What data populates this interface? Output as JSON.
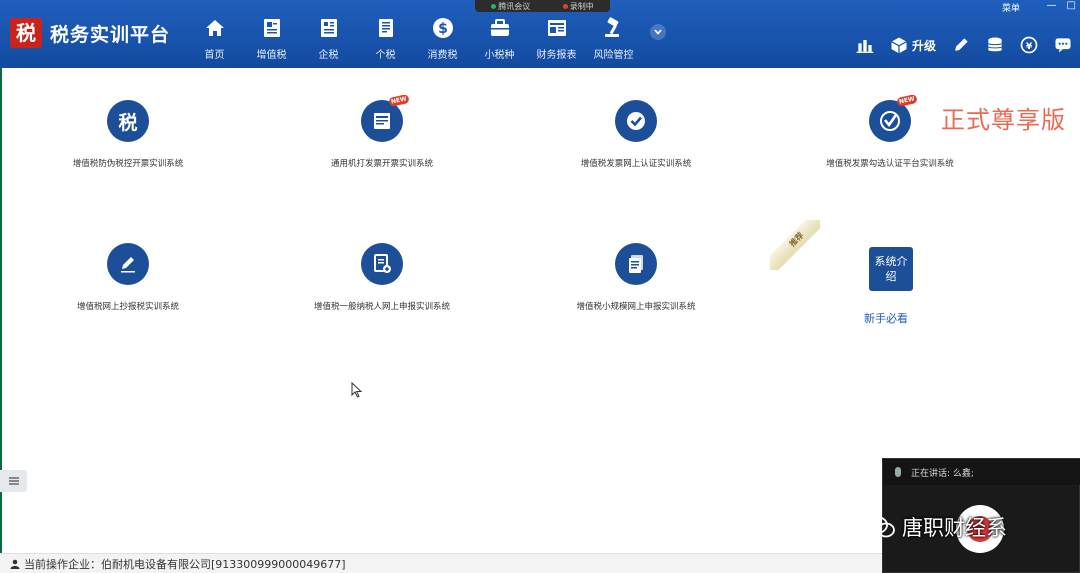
{
  "app": {
    "logo_char": "税",
    "title": "税务实训平台"
  },
  "meeting": {
    "name": "腾讯会议",
    "recording": "录制中"
  },
  "nav": {
    "items": [
      {
        "label": "首页",
        "icon": "home-icon"
      },
      {
        "label": "增值税",
        "icon": "document-icon"
      },
      {
        "label": "企税",
        "icon": "building-icon"
      },
      {
        "label": "个税",
        "icon": "person-doc-icon"
      },
      {
        "label": "消费税",
        "icon": "dollar-icon"
      },
      {
        "label": "小税种",
        "icon": "briefcase-icon"
      },
      {
        "label": "财务报表",
        "icon": "report-icon"
      },
      {
        "label": "风险管控",
        "icon": "gavel-icon"
      }
    ]
  },
  "toolbar": {
    "upgrade_label": "升级",
    "menu_label": "菜单"
  },
  "modules": [
    {
      "label": "增值税防伪税控开票实训系统",
      "icon": "tax-char-icon"
    },
    {
      "label": "通用机打发票开票实训系统",
      "icon": "invoice-new-icon",
      "badge": "NEW"
    },
    {
      "label": "增值税发票网上认证实训系统",
      "icon": "check-circle-icon"
    },
    {
      "label": "增值税发票勾选认证平台实训系统",
      "icon": "check-shield-icon",
      "badge": "NEW"
    },
    {
      "label": "增值税网上抄报税实训系统",
      "icon": "pen-icon"
    },
    {
      "label": "增值税一般纳税人网上申报实训系统",
      "icon": "doc-add-icon"
    },
    {
      "label": "增值税小规模网上申报实训系统",
      "icon": "files-icon"
    }
  ],
  "premium_label": "正式尊享版",
  "recommend_ribbon": "推荐",
  "intro": {
    "box_label": "系统介绍",
    "link_label": "新手必看"
  },
  "status": {
    "company": "当前操作企业：伯耐机电设备有限公司[913300999000049677]"
  },
  "speaker": {
    "label": "正在讲话: 么鑫;"
  },
  "watermark": "唐职财经系",
  "colors": {
    "header_blue": "#1a56ad",
    "icon_blue": "#1c4f98",
    "premium_orange": "#ea6a52",
    "new_red": "#e43a2a"
  }
}
